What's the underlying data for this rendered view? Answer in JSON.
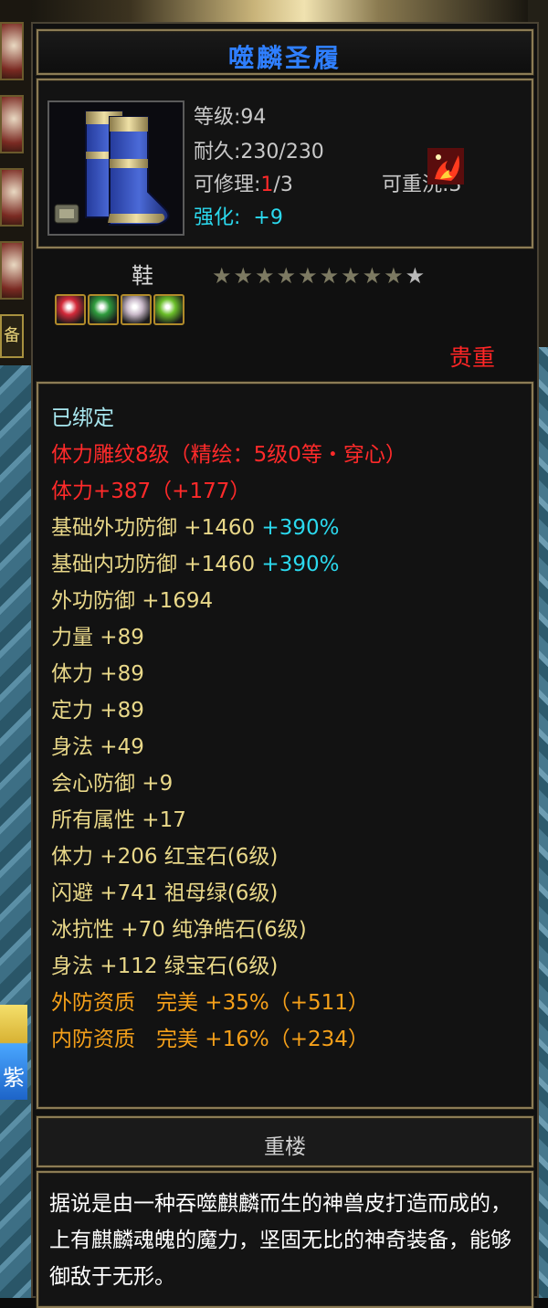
{
  "item": {
    "name": "噬麟圣履",
    "name_color": "#2f7fff",
    "level_text": "等级:94",
    "durability_text": "耐久:230/230",
    "repair_label": "可修理:",
    "repair_current": "1",
    "repair_max": "/3",
    "reroll_text": "可重洗:3",
    "enhance_label": "强化:",
    "enhance_value": "+9",
    "type": "鞋",
    "stars_total": 10,
    "stars_filled": 9,
    "rarity": "贵重",
    "icon": "blue-boots-icon",
    "skill_icon": "flame-skill-icon",
    "gem_slots": [
      {
        "icon": "red-gem-icon",
        "color": "#d42a3a"
      },
      {
        "icon": "green-gem-icon",
        "color": "#2f9c3e"
      },
      {
        "icon": "white-gem-icon",
        "color": "#c9b9c9"
      },
      {
        "icon": "emerald-gem-icon",
        "color": "#6bbf2a"
      }
    ]
  },
  "attributes": [
    {
      "text": "已绑定",
      "color": "cyan"
    },
    {
      "text": "体力雕纹8级（精绘：5级0等・穿心）",
      "color": "red"
    },
    {
      "text": "体力+387（+177）",
      "color": "red"
    },
    {
      "text": "基础外功防御 +1460",
      "extra": "+390%",
      "color": "gold"
    },
    {
      "text": "基础内功防御 +1460",
      "extra": "+390%",
      "color": "gold"
    },
    {
      "text": "外功防御 +1694",
      "color": "gold"
    },
    {
      "text": "力量 +89",
      "color": "gold"
    },
    {
      "text": "体力 +89",
      "color": "gold"
    },
    {
      "text": "定力 +89",
      "color": "gold"
    },
    {
      "text": "身法 +49",
      "color": "gold"
    },
    {
      "text": "会心防御 +9",
      "color": "gold"
    },
    {
      "text": "所有属性 +17",
      "color": "gold"
    },
    {
      "text": "体力 +206 红宝石(6级)",
      "color": "gold"
    },
    {
      "text": "闪避 +741 祖母绿(6级)",
      "color": "gold"
    },
    {
      "text": "冰抗性 +70 纯净皓石(6级)",
      "color": "gold"
    },
    {
      "text": "身法 +112 绿宝石(6级)",
      "color": "gold"
    },
    {
      "text": "外防资质　完美 +35%（+511）",
      "color": "orange"
    },
    {
      "text": "内防资质　完美 +16%（+234）",
      "color": "orange"
    }
  ],
  "set_name": "重楼",
  "description": "据说是由一种吞噬麒麟而生的神兽皮打造而成的，上有麒麟魂魄的魔力，坚固无比的神奇装备，能够御敌于无形。",
  "side": {
    "tab_label": "备",
    "badge_label": "紫"
  }
}
